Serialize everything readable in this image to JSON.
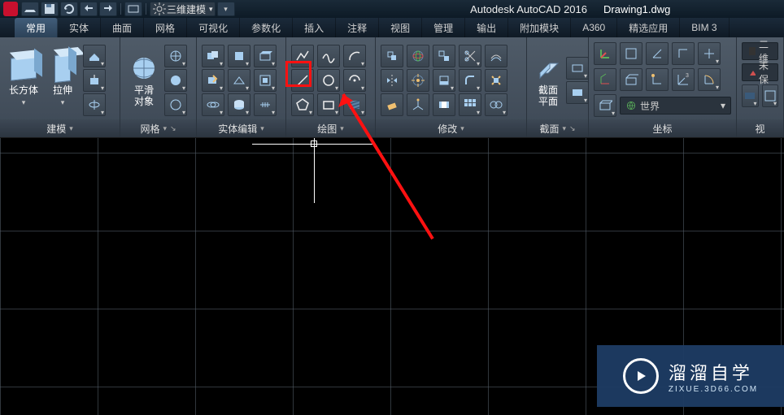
{
  "title": {
    "app": "Autodesk AutoCAD 2016",
    "doc": "Drawing1.dwg",
    "workspace": "三维建模"
  },
  "tabs": [
    "常用",
    "实体",
    "曲面",
    "网格",
    "可视化",
    "参数化",
    "插入",
    "注释",
    "视图",
    "管理",
    "输出",
    "附加模块",
    "A360",
    "精选应用",
    "BIM 3"
  ],
  "active_tab": 0,
  "panels": {
    "model": {
      "title": "建模",
      "big": [
        {
          "label": "长方体",
          "icon": "box"
        },
        {
          "label": "拉伸",
          "icon": "extrude"
        }
      ]
    },
    "mesh": {
      "title": "网格",
      "big": [
        {
          "label": "平滑\n对象",
          "icon": "smooth"
        }
      ]
    },
    "solided": {
      "title": "实体编辑"
    },
    "draw": {
      "title": "绘图"
    },
    "modify": {
      "title": "修改"
    },
    "section": {
      "title": "截面",
      "big": [
        {
          "label": "截面\n平面",
          "icon": "section"
        }
      ]
    },
    "coord": {
      "title": "坐标",
      "dropdown_value": "世界"
    },
    "view": {
      "title": "视",
      "unplaced_prefix": "未保"
    }
  },
  "extra_tab1": "二维",
  "watermark": {
    "big": "溜溜自学",
    "small": "ZIXUE.3D66.COM"
  }
}
